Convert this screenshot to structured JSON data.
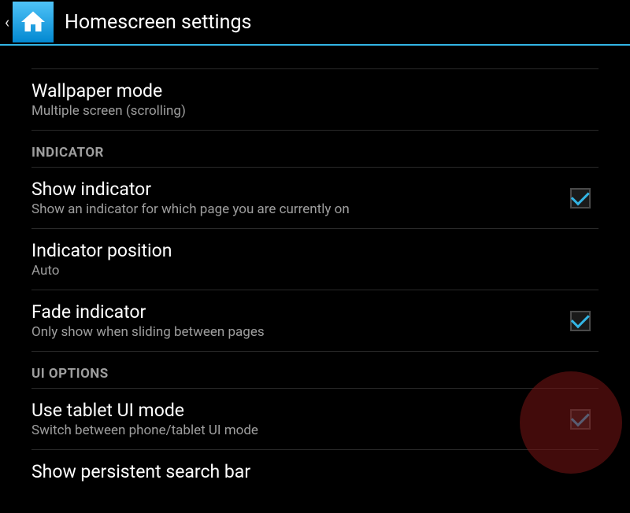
{
  "header": {
    "title": "Homescreen settings"
  },
  "items": {
    "wallpaper_mode": {
      "title": "Wallpaper mode",
      "subtitle": "Multiple screen (scrolling)"
    },
    "section_indicator": "INDICATOR",
    "show_indicator": {
      "title": "Show indicator",
      "subtitle": "Show an indicator for which page you are currently on",
      "checked": true
    },
    "indicator_position": {
      "title": "Indicator position",
      "subtitle": "Auto"
    },
    "fade_indicator": {
      "title": "Fade indicator",
      "subtitle": "Only show when sliding between pages",
      "checked": true
    },
    "section_ui_options": "UI OPTIONS",
    "use_tablet_ui": {
      "title": "Use tablet UI mode",
      "subtitle": "Switch between phone/tablet UI mode",
      "checked": true
    },
    "show_search_bar": {
      "title": "Show persistent search bar"
    }
  }
}
